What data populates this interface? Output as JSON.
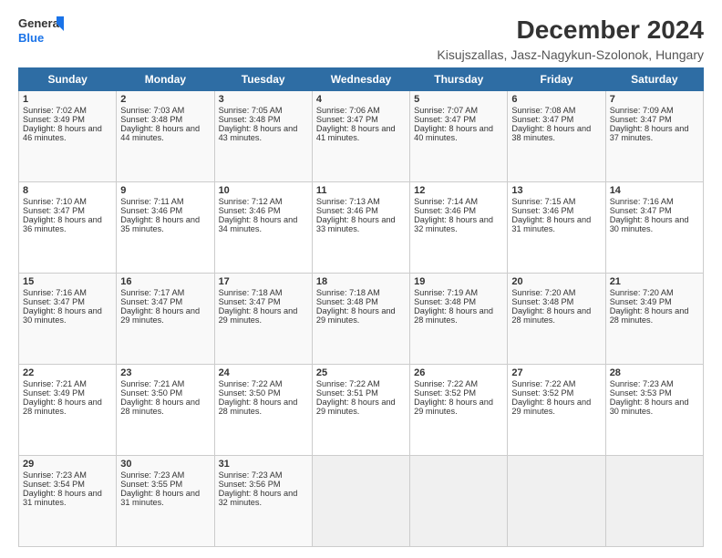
{
  "logo": {
    "line1": "General",
    "line2": "Blue"
  },
  "title": "December 2024",
  "subtitle": "Kisujszallas, Jasz-Nagykun-Szolonk, Hungary",
  "subtitle_full": "Kisujszallas, Jasz-Nagykun-Szolonok, Hungary",
  "days_of_week": [
    "Sunday",
    "Monday",
    "Tuesday",
    "Wednesday",
    "Thursday",
    "Friday",
    "Saturday"
  ],
  "weeks": [
    [
      {
        "day": 1,
        "sunrise": "7:02 AM",
        "sunset": "3:49 PM",
        "daylight": "8 hours and 46 minutes."
      },
      {
        "day": 2,
        "sunrise": "7:03 AM",
        "sunset": "3:48 PM",
        "daylight": "8 hours and 44 minutes."
      },
      {
        "day": 3,
        "sunrise": "7:05 AM",
        "sunset": "3:48 PM",
        "daylight": "8 hours and 43 minutes."
      },
      {
        "day": 4,
        "sunrise": "7:06 AM",
        "sunset": "3:47 PM",
        "daylight": "8 hours and 41 minutes."
      },
      {
        "day": 5,
        "sunrise": "7:07 AM",
        "sunset": "3:47 PM",
        "daylight": "8 hours and 40 minutes."
      },
      {
        "day": 6,
        "sunrise": "7:08 AM",
        "sunset": "3:47 PM",
        "daylight": "8 hours and 38 minutes."
      },
      {
        "day": 7,
        "sunrise": "7:09 AM",
        "sunset": "3:47 PM",
        "daylight": "8 hours and 37 minutes."
      }
    ],
    [
      {
        "day": 8,
        "sunrise": "7:10 AM",
        "sunset": "3:47 PM",
        "daylight": "8 hours and 36 minutes."
      },
      {
        "day": 9,
        "sunrise": "7:11 AM",
        "sunset": "3:46 PM",
        "daylight": "8 hours and 35 minutes."
      },
      {
        "day": 10,
        "sunrise": "7:12 AM",
        "sunset": "3:46 PM",
        "daylight": "8 hours and 34 minutes."
      },
      {
        "day": 11,
        "sunrise": "7:13 AM",
        "sunset": "3:46 PM",
        "daylight": "8 hours and 33 minutes."
      },
      {
        "day": 12,
        "sunrise": "7:14 AM",
        "sunset": "3:46 PM",
        "daylight": "8 hours and 32 minutes."
      },
      {
        "day": 13,
        "sunrise": "7:15 AM",
        "sunset": "3:46 PM",
        "daylight": "8 hours and 31 minutes."
      },
      {
        "day": 14,
        "sunrise": "7:16 AM",
        "sunset": "3:47 PM",
        "daylight": "8 hours and 30 minutes."
      }
    ],
    [
      {
        "day": 15,
        "sunrise": "7:16 AM",
        "sunset": "3:47 PM",
        "daylight": "8 hours and 30 minutes."
      },
      {
        "day": 16,
        "sunrise": "7:17 AM",
        "sunset": "3:47 PM",
        "daylight": "8 hours and 29 minutes."
      },
      {
        "day": 17,
        "sunrise": "7:18 AM",
        "sunset": "3:47 PM",
        "daylight": "8 hours and 29 minutes."
      },
      {
        "day": 18,
        "sunrise": "7:18 AM",
        "sunset": "3:48 PM",
        "daylight": "8 hours and 29 minutes."
      },
      {
        "day": 19,
        "sunrise": "7:19 AM",
        "sunset": "3:48 PM",
        "daylight": "8 hours and 28 minutes."
      },
      {
        "day": 20,
        "sunrise": "7:20 AM",
        "sunset": "3:48 PM",
        "daylight": "8 hours and 28 minutes."
      },
      {
        "day": 21,
        "sunrise": "7:20 AM",
        "sunset": "3:49 PM",
        "daylight": "8 hours and 28 minutes."
      }
    ],
    [
      {
        "day": 22,
        "sunrise": "7:21 AM",
        "sunset": "3:49 PM",
        "daylight": "8 hours and 28 minutes."
      },
      {
        "day": 23,
        "sunrise": "7:21 AM",
        "sunset": "3:50 PM",
        "daylight": "8 hours and 28 minutes."
      },
      {
        "day": 24,
        "sunrise": "7:22 AM",
        "sunset": "3:50 PM",
        "daylight": "8 hours and 28 minutes."
      },
      {
        "day": 25,
        "sunrise": "7:22 AM",
        "sunset": "3:51 PM",
        "daylight": "8 hours and 29 minutes."
      },
      {
        "day": 26,
        "sunrise": "7:22 AM",
        "sunset": "3:52 PM",
        "daylight": "8 hours and 29 minutes."
      },
      {
        "day": 27,
        "sunrise": "7:22 AM",
        "sunset": "3:52 PM",
        "daylight": "8 hours and 29 minutes."
      },
      {
        "day": 28,
        "sunrise": "7:23 AM",
        "sunset": "3:53 PM",
        "daylight": "8 hours and 30 minutes."
      }
    ],
    [
      {
        "day": 29,
        "sunrise": "7:23 AM",
        "sunset": "3:54 PM",
        "daylight": "8 hours and 31 minutes."
      },
      {
        "day": 30,
        "sunrise": "7:23 AM",
        "sunset": "3:55 PM",
        "daylight": "8 hours and 31 minutes."
      },
      {
        "day": 31,
        "sunrise": "7:23 AM",
        "sunset": "3:56 PM",
        "daylight": "8 hours and 32 minutes."
      },
      null,
      null,
      null,
      null
    ]
  ]
}
